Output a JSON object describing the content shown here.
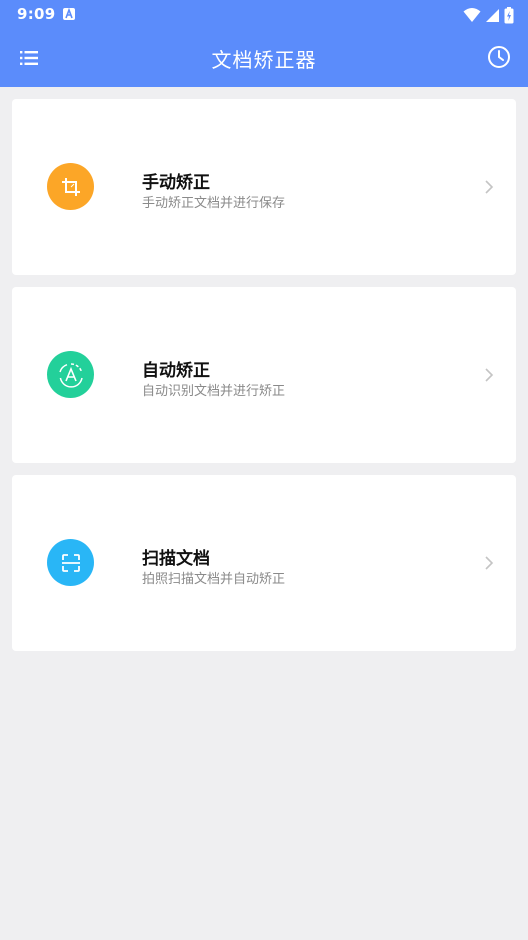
{
  "status_bar": {
    "time": "9:09"
  },
  "app_bar": {
    "title": "文档矫正器",
    "menu_icon": "list-menu-icon",
    "history_icon": "clock-history-icon"
  },
  "colors": {
    "primary": "#5b8cfb",
    "background": "#efeff1",
    "manual": "#fca627",
    "auto": "#23d09a",
    "scan": "#29b6f6"
  },
  "cards": [
    {
      "title": "手动矫正",
      "subtitle": "手动矫正文档并进行保存",
      "icon": "crop-icon"
    },
    {
      "title": "自动矫正",
      "subtitle": "自动识别文档并进行矫正",
      "icon": "auto-rotate-icon"
    },
    {
      "title": "扫描文档",
      "subtitle": "拍照扫描文档并自动矫正",
      "icon": "scan-frame-icon"
    }
  ]
}
